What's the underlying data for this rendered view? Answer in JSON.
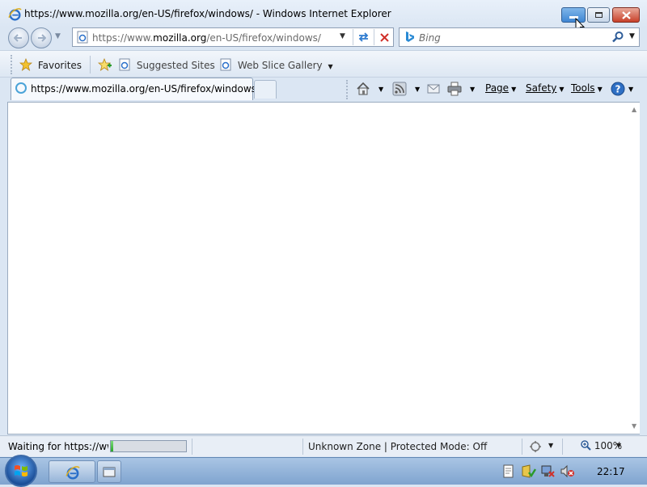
{
  "window": {
    "title": "https://www.mozilla.org/en-US/firefox/windows/ - Windows Internet Explorer"
  },
  "address": {
    "prefix": "https://www.",
    "domain": "mozilla.org",
    "path": "/en-US/firefox/windows/"
  },
  "search": {
    "placeholder": "Bing"
  },
  "favorites": {
    "favorites_label": "Favorites",
    "suggested_label": "Suggested Sites",
    "webslice_label": "Web Slice Gallery"
  },
  "tab": {
    "label": "https://www.mozilla.org/en-US/firefox/windows/"
  },
  "commands": {
    "page": "Page",
    "safety": "Safety",
    "tools": "Tools"
  },
  "status": {
    "text": "Waiting for https://www.mozilla.org/en-US/firefox/windows/",
    "progress": 0.03,
    "zone": "Unknown Zone | Protected Mode: Off",
    "zoom": "100%"
  },
  "taskbar": {
    "clock": "22:17"
  },
  "colors": {
    "accent": "#3f86d3",
    "close": "#c8412a",
    "progress": "#2aa72a"
  }
}
